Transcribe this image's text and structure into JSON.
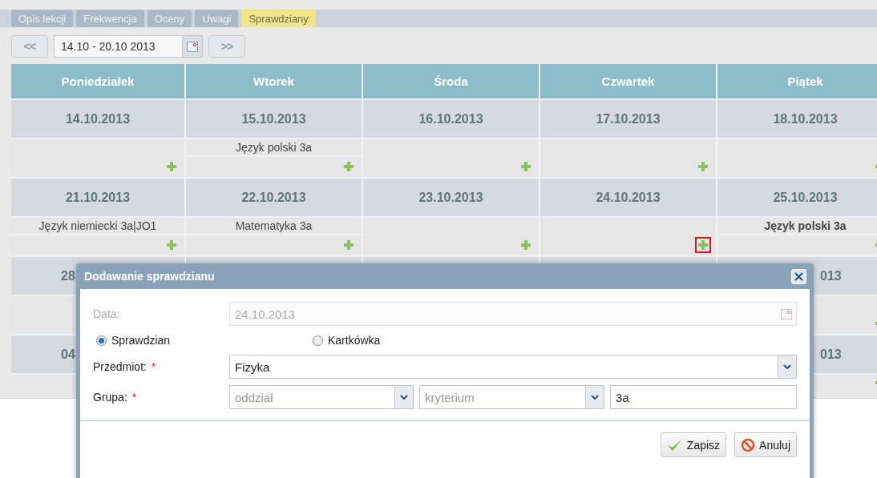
{
  "tabs": [
    {
      "label": "Opis lekcji",
      "selected": false
    },
    {
      "label": "Frekwencja",
      "selected": false
    },
    {
      "label": "Oceny",
      "selected": false
    },
    {
      "label": "Uwagi",
      "selected": false
    },
    {
      "label": "Sprawdziany",
      "selected": true
    }
  ],
  "week_nav": {
    "prev": "<<",
    "range": "14.10 - 20.10 2013",
    "next": ">>"
  },
  "calendar": {
    "days": [
      "Poniedziałek",
      "Wtorek",
      "Środa",
      "Czwartek",
      "Piątek"
    ],
    "weeks": [
      {
        "kind": "full",
        "dates": [
          "14.10.2013",
          "15.10.2013",
          "16.10.2013",
          "17.10.2013",
          "18.10.2013"
        ],
        "cells": [
          {
            "highlighted": false
          },
          {
            "entry": {
              "text": "Język polski 3a",
              "bold": false
            },
            "highlighted": false
          },
          {
            "highlighted": false
          },
          {
            "highlighted": false
          },
          {
            "highlighted": false
          }
        ]
      },
      {
        "kind": "full",
        "dates": [
          "21.10.2013",
          "22.10.2013",
          "23.10.2013",
          "24.10.2013",
          "25.10.2013"
        ],
        "cells": [
          {
            "entry": {
              "text": "Język niemiecki 3a|JO1",
              "bold": false
            },
            "highlighted": false
          },
          {
            "entry": {
              "text": "Matematyka 3a",
              "bold": false
            },
            "highlighted": false
          },
          {
            "highlighted": false
          },
          {
            "highlighted": true
          },
          {
            "entry": {
              "text": "Język polski 3a",
              "bold": true
            },
            "highlighted": false
          }
        ]
      },
      {
        "kind": "covered",
        "date_start": "28",
        "date_end": "013"
      },
      {
        "kind": "covered",
        "date_start": "04",
        "date_end": "013"
      }
    ]
  },
  "dialog": {
    "title": "Dodawanie sprawdzianu",
    "date": {
      "label": "Data:",
      "value": "24.10.2013",
      "disabled": true
    },
    "radios": [
      {
        "label": "Sprawdzian",
        "selected": true
      },
      {
        "label": "Kartkówka",
        "selected": false
      }
    ],
    "subject": {
      "label": "Przedmiot:",
      "required_mark": "*",
      "value": "Fizyka"
    },
    "group": {
      "label": "Grupa:",
      "required_mark": "*",
      "selects": [
        {
          "placeholder": "oddział"
        },
        {
          "placeholder": "kryterium"
        }
      ],
      "value": "3a"
    },
    "buttons": [
      {
        "kind": "save",
        "label": "Zapisz"
      },
      {
        "kind": "cancel",
        "label": "Anuluj"
      }
    ]
  }
}
